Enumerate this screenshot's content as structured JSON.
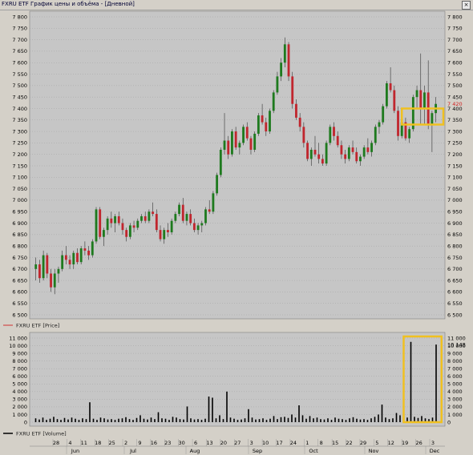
{
  "window": {
    "title": "FXRU ETF График цены и объёма - [Дневной]",
    "close_glyph": "×"
  },
  "colors": {
    "up": "#1e7a1e",
    "down": "#c0262e",
    "grid": "#9a9a9a",
    "panel_bg": "#c6c6c6",
    "highlight": "#f0c020",
    "last_price": "#d02020"
  },
  "chart_data": [
    {
      "type": "candlestick",
      "legend": "FXRU ETF [Price]",
      "ylim": [
        6500,
        7800
      ],
      "y_ticks": [
        "6 500",
        "6 550",
        "6 600",
        "6 650",
        "6 700",
        "6 750",
        "6 800",
        "6 850",
        "6 900",
        "6 950",
        "7 000",
        "7 050",
        "7 100",
        "7 150",
        "7 200",
        "7 250",
        "7 300",
        "7 350",
        "7 400",
        "7 450",
        "7 500",
        "7 550",
        "7 600",
        "7 650",
        "7 700",
        "7 750",
        "7 800"
      ],
      "last_value_label": "7 420",
      "candles": [
        [
          6700,
          6750,
          6650,
          6720
        ],
        [
          6720,
          6740,
          6640,
          6660
        ],
        [
          6660,
          6780,
          6650,
          6760
        ],
        [
          6760,
          6770,
          6660,
          6680
        ],
        [
          6680,
          6700,
          6600,
          6620
        ],
        [
          6620,
          6700,
          6590,
          6680
        ],
        [
          6680,
          6710,
          6640,
          6700
        ],
        [
          6700,
          6780,
          6690,
          6760
        ],
        [
          6760,
          6800,
          6720,
          6740
        ],
        [
          6740,
          6760,
          6700,
          6720
        ],
        [
          6720,
          6780,
          6700,
          6770
        ],
        [
          6770,
          6790,
          6720,
          6730
        ],
        [
          6730,
          6800,
          6720,
          6790
        ],
        [
          6790,
          6820,
          6760,
          6780
        ],
        [
          6780,
          6800,
          6740,
          6760
        ],
        [
          6760,
          6830,
          6750,
          6820
        ],
        [
          6820,
          6970,
          6810,
          6960
        ],
        [
          6960,
          6970,
          6830,
          6840
        ],
        [
          6840,
          6880,
          6800,
          6870
        ],
        [
          6870,
          6930,
          6850,
          6920
        ],
        [
          6920,
          6950,
          6880,
          6900
        ],
        [
          6900,
          6940,
          6860,
          6930
        ],
        [
          6930,
          6950,
          6890,
          6900
        ],
        [
          6900,
          6920,
          6850,
          6870
        ],
        [
          6870,
          6880,
          6820,
          6840
        ],
        [
          6840,
          6900,
          6830,
          6890
        ],
        [
          6890,
          6910,
          6860,
          6880
        ],
        [
          6880,
          6920,
          6870,
          6910
        ],
        [
          6910,
          6940,
          6900,
          6930
        ],
        [
          6930,
          6950,
          6900,
          6910
        ],
        [
          6910,
          6960,
          6900,
          6950
        ],
        [
          6950,
          6990,
          6930,
          6940
        ],
        [
          6940,
          6960,
          6860,
          6870
        ],
        [
          6870,
          6890,
          6820,
          6830
        ],
        [
          6830,
          6880,
          6810,
          6870
        ],
        [
          6870,
          6900,
          6840,
          6860
        ],
        [
          6860,
          6920,
          6850,
          6910
        ],
        [
          6910,
          6950,
          6900,
          6940
        ],
        [
          6940,
          6990,
          6930,
          6980
        ],
        [
          6980,
          7010,
          6900,
          6910
        ],
        [
          6910,
          6950,
          6890,
          6940
        ],
        [
          6940,
          6960,
          6890,
          6900
        ],
        [
          6900,
          6920,
          6860,
          6870
        ],
        [
          6870,
          6900,
          6850,
          6890
        ],
        [
          6890,
          6910,
          6860,
          6900
        ],
        [
          6900,
          6970,
          6890,
          6960
        ],
        [
          6960,
          7000,
          6940,
          6950
        ],
        [
          6950,
          7040,
          6940,
          7030
        ],
        [
          7030,
          7120,
          7020,
          7110
        ],
        [
          7110,
          7230,
          7100,
          7220
        ],
        [
          7220,
          7380,
          7200,
          7260
        ],
        [
          7260,
          7280,
          7180,
          7200
        ],
        [
          7200,
          7310,
          7190,
          7300
        ],
        [
          7300,
          7320,
          7220,
          7230
        ],
        [
          7230,
          7260,
          7200,
          7250
        ],
        [
          7250,
          7330,
          7240,
          7320
        ],
        [
          7320,
          7340,
          7260,
          7270
        ],
        [
          7270,
          7280,
          7200,
          7220
        ],
        [
          7220,
          7300,
          7210,
          7290
        ],
        [
          7290,
          7380,
          7280,
          7370
        ],
        [
          7370,
          7420,
          7330,
          7340
        ],
        [
          7340,
          7360,
          7280,
          7300
        ],
        [
          7300,
          7400,
          7290,
          7390
        ],
        [
          7390,
          7480,
          7380,
          7470
        ],
        [
          7470,
          7560,
          7460,
          7540
        ],
        [
          7540,
          7620,
          7520,
          7600
        ],
        [
          7600,
          7710,
          7580,
          7680
        ],
        [
          7680,
          7690,
          7520,
          7540
        ],
        [
          7540,
          7560,
          7400,
          7420
        ],
        [
          7420,
          7440,
          7350,
          7360
        ],
        [
          7360,
          7380,
          7300,
          7320
        ],
        [
          7320,
          7340,
          7230,
          7250
        ],
        [
          7250,
          7260,
          7170,
          7180
        ],
        [
          7180,
          7230,
          7150,
          7220
        ],
        [
          7220,
          7280,
          7190,
          7200
        ],
        [
          7200,
          7250,
          7160,
          7180
        ],
        [
          7180,
          7200,
          7150,
          7160
        ],
        [
          7160,
          7260,
          7150,
          7250
        ],
        [
          7250,
          7330,
          7240,
          7320
        ],
        [
          7320,
          7340,
          7260,
          7280
        ],
        [
          7280,
          7300,
          7230,
          7240
        ],
        [
          7240,
          7260,
          7180,
          7200
        ],
        [
          7200,
          7220,
          7160,
          7180
        ],
        [
          7180,
          7240,
          7170,
          7230
        ],
        [
          7230,
          7260,
          7200,
          7210
        ],
        [
          7210,
          7230,
          7160,
          7170
        ],
        [
          7170,
          7200,
          7150,
          7190
        ],
        [
          7190,
          7240,
          7180,
          7230
        ],
        [
          7230,
          7270,
          7200,
          7210
        ],
        [
          7210,
          7260,
          7190,
          7250
        ],
        [
          7250,
          7330,
          7240,
          7320
        ],
        [
          7320,
          7350,
          7290,
          7340
        ],
        [
          7340,
          7420,
          7330,
          7410
        ],
        [
          7410,
          7520,
          7400,
          7510
        ],
        [
          7510,
          7580,
          7470,
          7480
        ],
        [
          7480,
          7500,
          7380,
          7390
        ],
        [
          7390,
          7410,
          7260,
          7280
        ],
        [
          7280,
          7350,
          7270,
          7340
        ],
        [
          7340,
          7360,
          7260,
          7270
        ],
        [
          7270,
          7320,
          7250,
          7310
        ],
        [
          7310,
          7460,
          7300,
          7450
        ],
        [
          7450,
          7500,
          7400,
          7480
        ],
        [
          7480,
          7640,
          7330,
          7400
        ],
        [
          7400,
          7500,
          7330,
          7470
        ],
        [
          7470,
          7610,
          7310,
          7330
        ],
        [
          7330,
          7390,
          7210,
          7380
        ],
        [
          7380,
          7450,
          7340,
          7420
        ]
      ]
    },
    {
      "type": "bar",
      "legend": "FXRU ETF [Volume]",
      "ylim": [
        0,
        11000
      ],
      "y_ticks": [
        "0",
        "1 000",
        "2 000",
        "3 000",
        "4 000",
        "5 000",
        "6 000",
        "7 000",
        "8 000",
        "9 000",
        "10 000",
        "11 000"
      ],
      "last_value_label": "10 148",
      "values": [
        500,
        350,
        600,
        300,
        450,
        700,
        400,
        300,
        550,
        350,
        600,
        450,
        300,
        500,
        400,
        2600,
        450,
        300,
        600,
        500,
        350,
        400,
        300,
        450,
        500,
        650,
        400,
        300,
        550,
        900,
        450,
        350,
        600,
        400,
        1300,
        500,
        450,
        300,
        700,
        600,
        400,
        350,
        2050,
        500,
        350,
        400,
        300,
        450,
        3350,
        3200,
        500,
        900,
        400,
        4000,
        600,
        450,
        300,
        350,
        500,
        1700,
        600,
        350,
        400,
        500,
        300,
        450,
        800,
        400,
        650,
        700,
        550,
        1000,
        600,
        2200,
        900,
        450,
        800,
        500,
        600,
        400,
        350,
        500,
        300,
        600,
        450,
        400,
        300,
        500,
        650,
        450,
        350,
        400,
        300,
        500,
        700,
        1000,
        2300,
        600,
        400,
        500,
        1200,
        900,
        1100,
        600,
        10500,
        700,
        550,
        800,
        500,
        400,
        600,
        10148
      ]
    }
  ],
  "time_axis": {
    "dates": [
      "28",
      "4",
      "11",
      "18",
      "25",
      "2",
      "9",
      "16",
      "23",
      "30",
      "6",
      "13",
      "20",
      "27",
      "3",
      "10",
      "17",
      "24",
      "1",
      "8",
      "15",
      "22",
      "29",
      "5",
      "12",
      "19",
      "26",
      "3"
    ],
    "months": [
      "Jun",
      "Jul",
      "Aug",
      "Sep",
      "Oct",
      "Nov",
      "Dec"
    ]
  }
}
